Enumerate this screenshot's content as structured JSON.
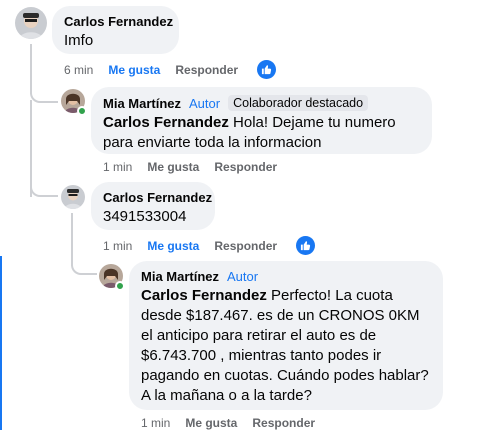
{
  "comments": [
    {
      "author": "Carlos Fernandez",
      "text": "Imfo",
      "time": "6 min",
      "like_label": "Me gusta",
      "reply_label": "Responder",
      "reaction": "like-icon"
    },
    {
      "author": "Mia Martínez",
      "author_badge": "Autor",
      "extra_badge": "Colaborador destacado",
      "mention": "Carlos Fernandez",
      "text": " Hola! Dejame tu numero para enviarte toda la informacion",
      "time": "1 min",
      "like_label": "Me gusta",
      "reply_label": "Responder"
    },
    {
      "author": "Carlos Fernandez",
      "text": "3491533004",
      "time": "1 min",
      "like_label": "Me gusta",
      "reply_label": "Responder",
      "reaction": "like-icon"
    },
    {
      "author": "Mia Martínez",
      "author_badge": "Autor",
      "mention": "Carlos Fernandez",
      "text": " Perfecto! La cuota desde $187.467. es de un CRONOS 0KM el anticipo para retirar el auto es de $6.743.700 , mientras tanto podes ir pagando en cuotas. Cuándo podes hablar? A la mañana o a la tarde?",
      "time": "1 min",
      "like_label": "Me gusta",
      "reply_label": "Responder"
    }
  ],
  "colors": {
    "accent": "#1877f2",
    "bubble": "#f0f2f5",
    "meta_text": "#65676b",
    "online": "#31a24c"
  }
}
